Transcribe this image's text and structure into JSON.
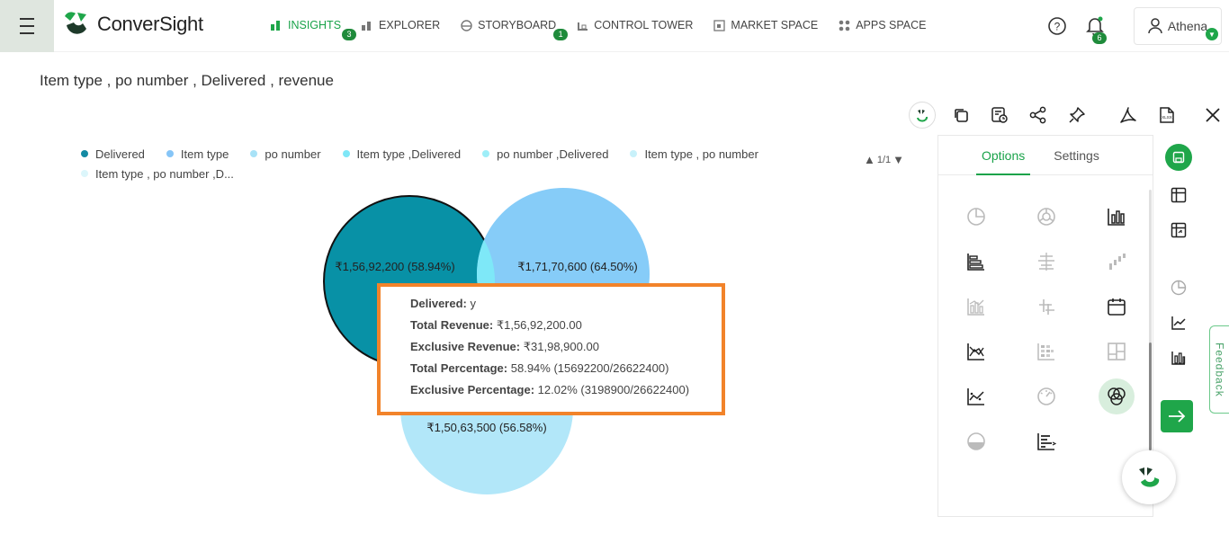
{
  "app": {
    "name": "ConverSight"
  },
  "nav": [
    {
      "label": "INSIGHTS",
      "badge": "3",
      "active": true,
      "icon": "bar-chart-icon"
    },
    {
      "label": "EXPLORER",
      "badge": "",
      "active": false,
      "icon": "explorer-icon"
    },
    {
      "label": "STORYBOARD",
      "badge": "1",
      "active": false,
      "icon": "storyboard-icon"
    },
    {
      "label": "CONTROL TOWER",
      "badge": "",
      "active": false,
      "icon": "control-tower-icon"
    },
    {
      "label": "MARKET SPACE",
      "badge": "",
      "active": false,
      "icon": "market-space-icon"
    },
    {
      "label": "APPS SPACE",
      "badge": "",
      "active": false,
      "icon": "apps-space-icon"
    }
  ],
  "header": {
    "notifications_count": "6",
    "user_name": "Athena"
  },
  "query": "Item type , po number , Delivered , revenue",
  "legend": [
    {
      "label": "Delivered",
      "color": "#138aa3"
    },
    {
      "label": "Item type",
      "color": "#86c5f7"
    },
    {
      "label": "po number",
      "color": "#a8e2f7"
    },
    {
      "label": "Item type  ,Delivered",
      "color": "#7fe7f7"
    },
    {
      "label": "po number ,Delivered",
      "color": "#9eeef8"
    },
    {
      "label": "Item type , po number",
      "color": "#c8f1fa"
    },
    {
      "label": "Item type , po number ,D...",
      "color": "#dcf6fb"
    }
  ],
  "pager": "1/1",
  "chart_data": {
    "type": "venn",
    "sets": [
      {
        "name": "Delivered",
        "value": 15692200,
        "label": "₹1,56,92,200 (58.94%)",
        "color": "#0891a6"
      },
      {
        "name": "Item type",
        "value": 17170600,
        "label": "₹1,71,70,600 (64.50%)",
        "color": "#86ccf8"
      },
      {
        "name": "po number",
        "value": 15063500,
        "label": "₹1,50,63,500 (56.58%)",
        "color": "#b2e7f9"
      }
    ],
    "intersection_color": "#7ee8f8"
  },
  "tooltip": {
    "lines": [
      {
        "key": "Delivered:",
        "value": "y"
      },
      {
        "key": "Total Revenue:",
        "value": "₹1,56,92,200.00"
      },
      {
        "key": "Exclusive Revenue:",
        "value": "₹31,98,900.00"
      },
      {
        "key": "Total Percentage:",
        "value": "58.94% (15692200/26622400)"
      },
      {
        "key": "Exclusive Percentage:",
        "value": "12.02% (3198900/26622400)"
      }
    ]
  },
  "panel": {
    "tabs": [
      "Options",
      "Settings"
    ],
    "active_tab": "Options"
  },
  "feedback_label": "Feedback",
  "colors": {
    "accent": "#1aa34a",
    "highlight": "#f2832a"
  }
}
